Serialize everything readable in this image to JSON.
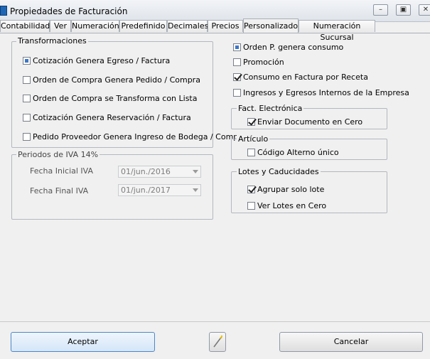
{
  "window": {
    "title": "Propiedades de Facturación",
    "buttons": [
      "minimize",
      "restore",
      "close"
    ]
  },
  "tabs": [
    {
      "label": "Contabilidad"
    },
    {
      "label": "Ver"
    },
    {
      "label": "Numeración"
    },
    {
      "label": "Predefinido"
    },
    {
      "label": "Decimales"
    },
    {
      "label": "Precios"
    },
    {
      "label": "Personalizado",
      "active": true
    },
    {
      "label": "Numeración Sucursal"
    }
  ],
  "transformaciones": {
    "title": "Transformaciones",
    "items": [
      {
        "label": "Cotización Genera Egreso / Factura",
        "state": "indeterminate"
      },
      {
        "label": "Orden de Compra Genera Pedido / Compra",
        "state": "unchecked"
      },
      {
        "label": "Orden de Compra se Transforma con Lista",
        "state": "unchecked"
      },
      {
        "label": "Cotización Genera Reservación / Factura",
        "state": "unchecked"
      },
      {
        "label": "Pedido Proveedor Genera Ingreso de Bodega / Compra",
        "state": "unchecked"
      }
    ]
  },
  "periodos_iva": {
    "title": "Periodos de IVA 14%",
    "fecha_inicial": {
      "label": "Fecha Inicial IVA",
      "value": "01/jun./2016"
    },
    "fecha_final": {
      "label": "Fecha Final IVA",
      "value": "01/jun./2017"
    }
  },
  "options": [
    {
      "label": "Orden P. genera consumo",
      "state": "indeterminate"
    },
    {
      "label": "Promoción",
      "state": "unchecked"
    },
    {
      "label": "Consumo en Factura por Receta",
      "state": "checked"
    },
    {
      "label": "Ingresos y Egresos Internos de la Empresa",
      "state": "unchecked"
    }
  ],
  "fact_electronica": {
    "title": "Fact. Electrónica",
    "items": [
      {
        "label": "Enviar Documento en Cero",
        "state": "checked"
      }
    ]
  },
  "articulo": {
    "title": "Artículo",
    "items": [
      {
        "label": "Código Alterno único",
        "state": "unchecked"
      }
    ]
  },
  "lotes": {
    "title": "Lotes y Caducidades",
    "items": [
      {
        "label": "Agrupar solo lote",
        "state": "checked"
      },
      {
        "label": "Ver Lotes en Cero",
        "state": "unchecked"
      }
    ]
  },
  "footer": {
    "accept_label": "Aceptar",
    "cancel_label": "Cancelar",
    "wand_icon": "magic-wand-icon"
  }
}
